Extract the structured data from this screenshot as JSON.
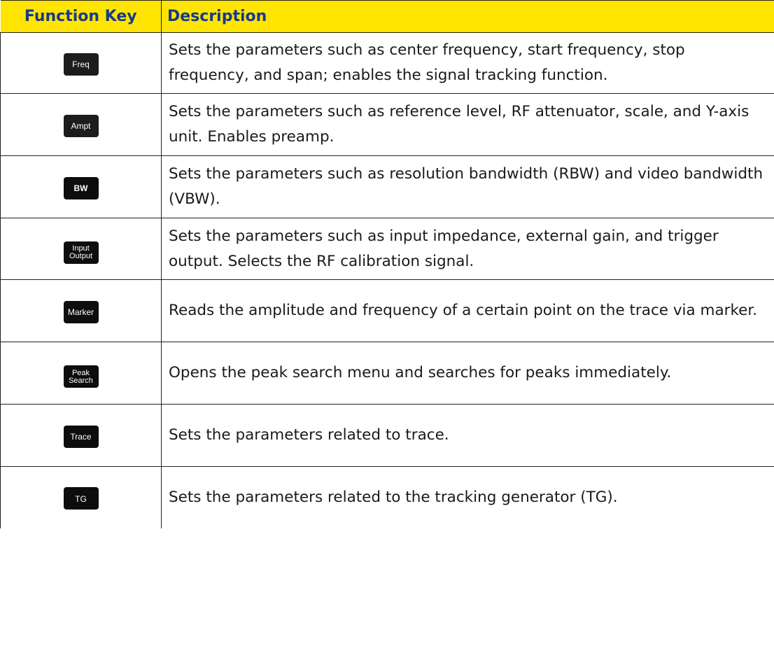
{
  "table": {
    "headers": {
      "key": "Function Key",
      "description": "Description"
    },
    "rows": [
      {
        "key_line1": "Freq",
        "key_line2": "",
        "description": "Sets the parameters such as center frequency, start frequency, stop frequency, and span; enables the signal tracking function."
      },
      {
        "key_line1": "Ampt",
        "key_line2": "",
        "description": "Sets the parameters such as reference level, RF attenuator, scale, and Y-axis unit. Enables preamp."
      },
      {
        "key_line1": "BW",
        "key_line2": "",
        "description": "Sets the parameters such as resolution bandwidth (RBW) and video bandwidth (VBW)."
      },
      {
        "key_line1": "Input",
        "key_line2": "Output",
        "description": "Sets the parameters such as input impedance, external gain, and trigger output. Selects the RF calibration signal."
      },
      {
        "key_line1": "Marker",
        "key_line2": "",
        "description": "Reads the amplitude and frequency of a certain point on the trace via marker."
      },
      {
        "key_line1": "Peak",
        "key_line2": "Search",
        "description": "Opens the peak search menu and searches for peaks immediately."
      },
      {
        "key_line1": "Trace",
        "key_line2": "",
        "description": "Sets the parameters related to trace."
      },
      {
        "key_line1": "TG",
        "key_line2": "",
        "description": "Sets the parameters related to the tracking generator (TG)."
      }
    ]
  },
  "colors": {
    "header_background": "#ffe500",
    "header_text": "#173a8c",
    "key_background": "#0d0d0d",
    "key_text": "#ffffff"
  }
}
